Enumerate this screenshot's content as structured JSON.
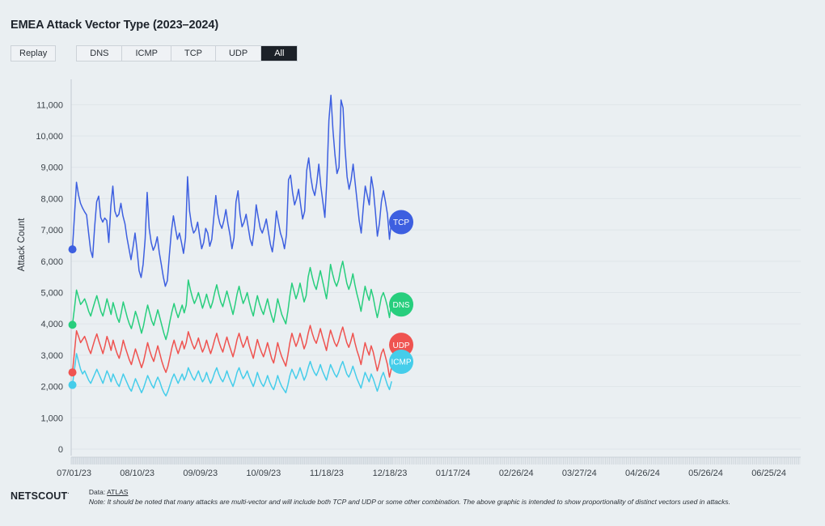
{
  "header": {
    "title": "EMEA Attack Vector Type (2023–2024)"
  },
  "toolbar": {
    "replay_label": "Replay",
    "tabs": [
      {
        "label": "DNS",
        "active": false
      },
      {
        "label": "ICMP",
        "active": false
      },
      {
        "label": "TCP",
        "active": false
      },
      {
        "label": "UDP",
        "active": false
      },
      {
        "label": "All",
        "active": true
      }
    ]
  },
  "footer": {
    "logo": "NETSCOUT",
    "data_label": "Data:",
    "data_source": "ATLAS",
    "note": "Note: It should be noted that many attacks are multi-vector and will include both TCP and UDP or some other combination. The above graphic is intended to show proportionality of distinct vectors used in attacks."
  },
  "chart_data": {
    "type": "line",
    "title": "EMEA Attack Vector Type (2023–2024)",
    "xlabel": "",
    "ylabel": "Attack Count",
    "ylim": [
      0,
      11500
    ],
    "yticks": [
      0,
      1000,
      2000,
      3000,
      4000,
      5000,
      6000,
      7000,
      8000,
      9000,
      10000,
      11000
    ],
    "ytick_labels": [
      "0",
      "1,000",
      "2,000",
      "3,000",
      "4,000",
      "5,000",
      "6,000",
      "7,000",
      "8,000",
      "9,000",
      "10,000",
      "11,000"
    ],
    "xtick_labels": [
      "07/01/23",
      "08/10/23",
      "09/09/23",
      "10/09/23",
      "11/18/23",
      "12/18/23",
      "01/17/24",
      "02/26/24",
      "03/27/24",
      "04/26/24",
      "05/26/24",
      "06/25/24"
    ],
    "xlim_labels": [
      "07/01/23",
      "06/25/24"
    ],
    "grid": true,
    "legend_position": "end-of-line-badges",
    "x_start": "07/01/23",
    "x_end": "12/18/23",
    "series": [
      {
        "name": "TCP",
        "color": "#3d5fe0",
        "badge_label": "TCP",
        "start_value": 6380,
        "values": [
          6380,
          7450,
          8520,
          8120,
          7850,
          7700,
          7580,
          7480,
          6900,
          6350,
          6120,
          7100,
          7900,
          8080,
          7400,
          7250,
          7380,
          7300,
          6600,
          7750,
          8400,
          7600,
          7420,
          7500,
          7850,
          7450,
          7200,
          6750,
          6400,
          6050,
          6450,
          6900,
          6350,
          5700,
          5480,
          5900,
          6700,
          8200,
          7050,
          6600,
          6350,
          6500,
          6780,
          6280,
          5900,
          5500,
          5200,
          5380,
          6200,
          6950,
          7450,
          7050,
          6700,
          6900,
          6600,
          6250,
          6750,
          8700,
          7600,
          7150,
          6900,
          7000,
          7250,
          6800,
          6400,
          6600,
          7050,
          6900,
          6480,
          6700,
          7400,
          8100,
          7500,
          7200,
          7050,
          7300,
          7650,
          7200,
          6850,
          6400,
          6750,
          7900,
          8250,
          7500,
          7100,
          7250,
          7500,
          7100,
          6700,
          6500,
          7000,
          7800,
          7400,
          7050,
          6900,
          7100,
          7350,
          6950,
          6550,
          6300,
          6800,
          7600,
          7250,
          6900,
          6700,
          6400,
          6850,
          8600,
          8750,
          8200,
          7800,
          8000,
          8300,
          7800,
          7350,
          7600,
          8900,
          9300,
          8700,
          8300,
          8100,
          8500,
          9100,
          8400,
          7900,
          7400,
          8600,
          10500,
          11300,
          10200,
          9400,
          8800,
          9000,
          11150,
          10900,
          9600,
          8700,
          8300,
          8600,
          9100,
          8500,
          7900,
          7300,
          6900,
          7700,
          8400,
          8100,
          7800,
          8700,
          8300,
          7600,
          6800,
          7200,
          7900,
          8250,
          7900,
          7500,
          6700,
          7300
        ]
      },
      {
        "name": "DNS",
        "color": "#27ce7d",
        "badge_label": "DNS",
        "start_value": 3970,
        "values": [
          3970,
          4500,
          5080,
          4850,
          4620,
          4700,
          4800,
          4620,
          4400,
          4250,
          4480,
          4700,
          4900,
          4650,
          4400,
          4250,
          4500,
          4800,
          4550,
          4300,
          4680,
          4450,
          4200,
          4050,
          4350,
          4700,
          4450,
          4200,
          4000,
          3850,
          4100,
          4400,
          4200,
          3950,
          3700,
          3950,
          4300,
          4600,
          4350,
          4100,
          3950,
          4200,
          4450,
          4200,
          3950,
          3700,
          3500,
          3750,
          4100,
          4400,
          4650,
          4400,
          4200,
          4400,
          4600,
          4350,
          4600,
          5400,
          5100,
          4850,
          4650,
          4800,
          5000,
          4750,
          4500,
          4700,
          4950,
          4700,
          4500,
          4700,
          5000,
          5250,
          4950,
          4700,
          4550,
          4800,
          5050,
          4800,
          4550,
          4300,
          4600,
          4950,
          5200,
          4900,
          4650,
          4800,
          5000,
          4700,
          4450,
          4250,
          4600,
          4900,
          4650,
          4450,
          4300,
          4550,
          4800,
          4500,
          4250,
          4050,
          4400,
          4800,
          4550,
          4300,
          4150,
          4000,
          4400,
          4900,
          5300,
          5050,
          4800,
          5000,
          5300,
          5000,
          4700,
          4900,
          5500,
          5800,
          5500,
          5250,
          5100,
          5400,
          5700,
          5400,
          5100,
          4800,
          5300,
          5900,
          5600,
          5350,
          5200,
          5400,
          5750,
          6000,
          5650,
          5300,
          5100,
          5300,
          5600,
          5250,
          4950,
          4700,
          4400,
          4800,
          5200,
          4950,
          4750,
          5100,
          4850,
          4500,
          4200,
          4500,
          4850,
          5000,
          4800,
          4550,
          4200,
          4700
        ]
      },
      {
        "name": "UDP",
        "color": "#ef5350",
        "badge_label": "UDP",
        "start_value": 2450,
        "values": [
          2450,
          3100,
          3780,
          3600,
          3400,
          3500,
          3600,
          3420,
          3200,
          3050,
          3280,
          3500,
          3680,
          3450,
          3250,
          3050,
          3300,
          3600,
          3400,
          3150,
          3480,
          3250,
          3050,
          2900,
          3150,
          3480,
          3250,
          3050,
          2850,
          2700,
          2950,
          3200,
          3000,
          2800,
          2600,
          2800,
          3100,
          3400,
          3150,
          2950,
          2800,
          3050,
          3300,
          3050,
          2800,
          2600,
          2450,
          2650,
          2950,
          3250,
          3480,
          3250,
          3050,
          3250,
          3450,
          3200,
          3400,
          3750,
          3550,
          3350,
          3200,
          3350,
          3550,
          3300,
          3100,
          3250,
          3480,
          3250,
          3050,
          3250,
          3500,
          3700,
          3450,
          3250,
          3100,
          3350,
          3580,
          3350,
          3150,
          2950,
          3200,
          3500,
          3700,
          3450,
          3250,
          3400,
          3600,
          3300,
          3100,
          2900,
          3200,
          3500,
          3280,
          3100,
          2950,
          3150,
          3400,
          3150,
          2900,
          2750,
          3050,
          3400,
          3150,
          2950,
          2800,
          2650,
          3000,
          3400,
          3700,
          3480,
          3280,
          3450,
          3700,
          3450,
          3200,
          3380,
          3700,
          3950,
          3700,
          3500,
          3380,
          3600,
          3850,
          3600,
          3380,
          3150,
          3500,
          3800,
          3600,
          3400,
          3280,
          3450,
          3700,
          3900,
          3650,
          3400,
          3250,
          3450,
          3700,
          3400,
          3150,
          2950,
          2700,
          3050,
          3400,
          3180,
          3000,
          3300,
          3100,
          2800,
          2500,
          2750,
          3050,
          3200,
          2950,
          2700,
          2300,
          2600
        ]
      },
      {
        "name": "ICMP",
        "color": "#45cdea",
        "badge_label": "ICMP",
        "start_value": 2050,
        "values": [
          2050,
          2550,
          3050,
          2800,
          2550,
          2400,
          2500,
          2350,
          2200,
          2100,
          2250,
          2400,
          2550,
          2400,
          2250,
          2100,
          2300,
          2500,
          2350,
          2150,
          2400,
          2250,
          2100,
          2000,
          2200,
          2400,
          2250,
          2100,
          1950,
          1850,
          2050,
          2250,
          2100,
          1950,
          1800,
          1950,
          2150,
          2350,
          2200,
          2050,
          1950,
          2150,
          2300,
          2150,
          1950,
          1800,
          1700,
          1850,
          2050,
          2250,
          2400,
          2250,
          2100,
          2250,
          2400,
          2200,
          2350,
          2600,
          2450,
          2300,
          2200,
          2350,
          2500,
          2300,
          2150,
          2250,
          2450,
          2250,
          2100,
          2250,
          2450,
          2600,
          2400,
          2250,
          2150,
          2300,
          2500,
          2300,
          2150,
          2000,
          2200,
          2450,
          2600,
          2400,
          2250,
          2350,
          2500,
          2300,
          2150,
          2000,
          2200,
          2450,
          2250,
          2100,
          2000,
          2150,
          2350,
          2150,
          2000,
          1900,
          2100,
          2350,
          2150,
          2000,
          1900,
          1800,
          2050,
          2350,
          2550,
          2400,
          2250,
          2400,
          2600,
          2400,
          2200,
          2350,
          2600,
          2800,
          2600,
          2450,
          2350,
          2500,
          2700,
          2500,
          2350,
          2200,
          2450,
          2700,
          2550,
          2400,
          2300,
          2450,
          2650,
          2800,
          2600,
          2400,
          2300,
          2450,
          2650,
          2450,
          2250,
          2100,
          1950,
          2200,
          2450,
          2300,
          2150,
          2400,
          2250,
          2050,
          1850,
          2050,
          2300,
          2450,
          2250,
          2050,
          1900,
          2150
        ]
      }
    ]
  }
}
